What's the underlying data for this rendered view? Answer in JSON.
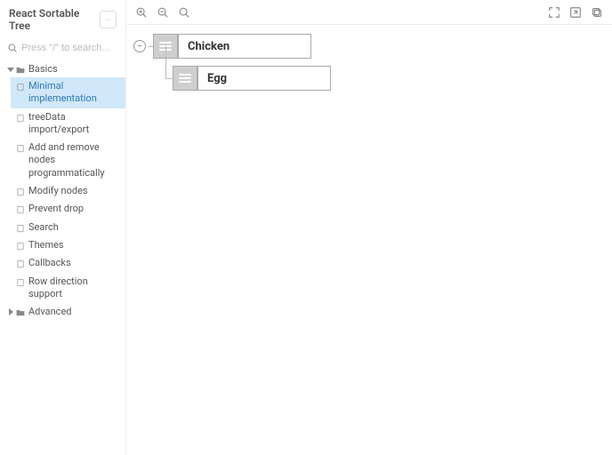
{
  "app": {
    "title": "React Sortable Tree"
  },
  "search": {
    "placeholder": "Press \"/\" to search..."
  },
  "sidebar": {
    "groups": [
      {
        "label": "Basics",
        "expanded": true,
        "items": [
          {
            "label": "Minimal implementation",
            "selected": true
          },
          {
            "label": "treeData import/export"
          },
          {
            "label": "Add and remove nodes programmatically"
          },
          {
            "label": "Modify nodes"
          },
          {
            "label": "Prevent drop"
          },
          {
            "label": "Search"
          },
          {
            "label": "Themes"
          },
          {
            "label": "Callbacks"
          },
          {
            "label": "Row direction support"
          }
        ]
      },
      {
        "label": "Advanced",
        "expanded": false,
        "items": []
      }
    ]
  },
  "tree": {
    "root": {
      "title": "Chicken"
    },
    "child": {
      "title": "Egg"
    }
  }
}
